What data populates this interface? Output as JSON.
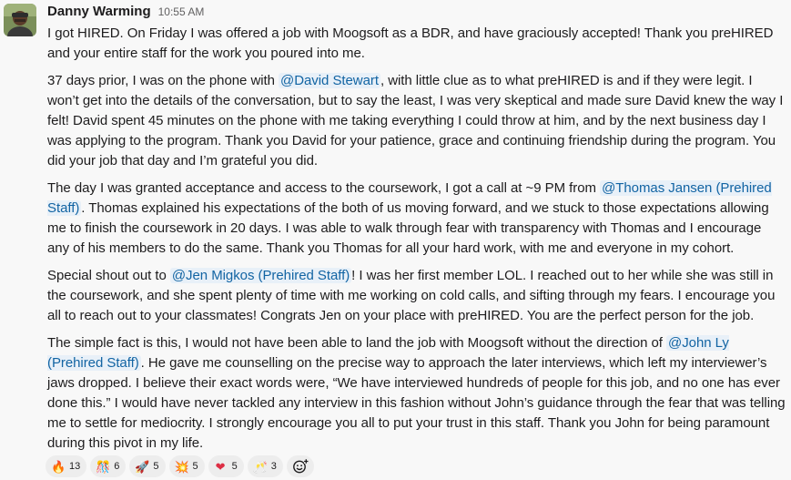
{
  "message": {
    "author": "Danny Warming",
    "timestamp": "10:55 AM",
    "paragraphs": [
      [
        {
          "text": "I got HIRED.  On Friday I was offered a job with Moogsoft as a BDR, and have graciously accepted!  Thank you preHIRED and your entire staff for the work you poured into me."
        }
      ],
      [
        {
          "text": "37 days prior, I was on the phone with "
        },
        {
          "text": "@David Stewart",
          "mention": true
        },
        {
          "text": ", with little clue as to what preHIRED is and if they were legit.  I won’t get into the details of the conversation, but to say the least, I was very skeptical and made sure David knew the way I felt!  David spent 45 minutes on the phone with me taking everything I could throw at him, and by the next business day I was applying to the program.  Thank you David for your patience, grace and continuing friendship during the program.  You did your job that day and I’m grateful you did."
        }
      ],
      [
        {
          "text": "The day I was granted acceptance and access to the coursework,  I got a call at ~9 PM from "
        },
        {
          "text": "@Thomas Jansen (Prehired Staff)",
          "mention": true
        },
        {
          "text": ".  Thomas explained his expectations of the both of us moving forward, and we stuck to those expectations allowing me to finish the coursework in 20 days.  I was able to walk through fear with transparency with Thomas and I encourage any of his members to do the same.  Thank you Thomas for all your hard work, with me and everyone in my cohort."
        }
      ],
      [
        {
          "text": "Special shout out to "
        },
        {
          "text": "@Jen Migkos (Prehired Staff)",
          "mention": true
        },
        {
          "text": "!  I was her first member LOL.  I reached out to her while she was still in the coursework, and she spent plenty of time with me working on cold calls, and sifting through my fears.  I encourage you all to reach out to your classmates!  Congrats Jen on your place with preHIRED. You are the perfect person for the job."
        }
      ],
      [
        {
          "text": "The simple fact is this, I would not have been able to land the job with Moogsoft without the direction of "
        },
        {
          "text": "@John Ly (Prehired Staff)",
          "mention": true
        },
        {
          "text": ".  He gave me counselling on the precise way to approach the later interviews, which left my interviewer’s jaws dropped.  I believe their exact words were, “We have interviewed hundreds of people for this job, and no one has ever done this.”  I would have never tackled any interview in this fashion without John’s guidance through the fear that was telling me to settle for mediocrity.  I strongly encourage you all to put your trust in this staff.   Thank you John for being paramount during this pivot in my life."
        }
      ]
    ]
  },
  "reactions": [
    {
      "icon": "fire-icon",
      "emoji": "🔥",
      "count": "13"
    },
    {
      "icon": "party-hat-icon",
      "emoji": "🎊",
      "count": "6"
    },
    {
      "icon": "rocket-icon",
      "emoji": "🚀",
      "count": "5"
    },
    {
      "icon": "boom-icon",
      "emoji": "💥",
      "count": "5"
    },
    {
      "icon": "red-heart-icon",
      "emoji": "❤",
      "count": "5"
    },
    {
      "icon": "clinking-glasses-icon",
      "emoji": "🥂",
      "count": "3"
    }
  ],
  "colors": {
    "background": "#f8f8f8",
    "mention_bg": "#e8f0f8",
    "mention_text": "#1264a3",
    "text": "#1d1c1d",
    "timestamp": "#616061"
  }
}
